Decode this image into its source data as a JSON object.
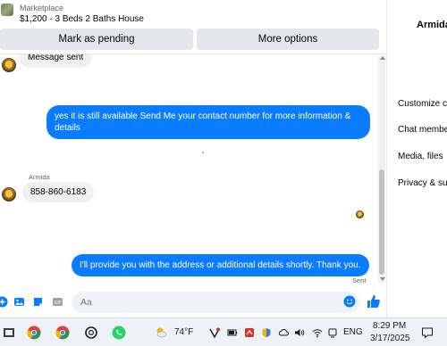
{
  "listing": {
    "source": "Marketplace",
    "title": "$1,200 - 3 Beds 2 Baths House"
  },
  "actions": {
    "mark_pending": "Mark as pending",
    "more_options": "More options"
  },
  "messages": {
    "partial_incoming": "Message sent",
    "outgoing_1": "yes it is still available Send Me your contact number for more information & details",
    "sender_name": "Armida",
    "incoming_phone": "858-860-6183",
    "outgoing_2": "I'll provide you with the address or additional details shortly. Thank you.",
    "sent_status": "Sent"
  },
  "composer": {
    "placeholder": "Aa"
  },
  "sidebar": {
    "contact_name": "Armida",
    "items": [
      {
        "label": "Customize c"
      },
      {
        "label": "Chat membe"
      },
      {
        "label": "Media, files"
      },
      {
        "label": "Privacy & su"
      }
    ]
  },
  "taskbar": {
    "weather": "74°F",
    "language": "ENG",
    "time": "8:29 PM",
    "date": "3/17/2025"
  },
  "colors": {
    "accent": "#0a7cff",
    "bubble_in": "#f0f0f0",
    "button_bg": "#e4e6eb"
  }
}
